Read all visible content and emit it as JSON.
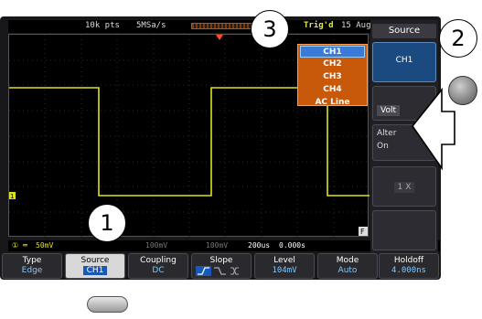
{
  "top_bar": {
    "record_length": "10k pts",
    "sample_rate": "5MSa/s",
    "trigger_status": "Trig'd",
    "date": "15 Aug"
  },
  "source_dropdown": {
    "items": [
      "CH1",
      "CH2",
      "CH3",
      "CH4",
      "AC Line"
    ],
    "selected": "CH1"
  },
  "side_menu": {
    "title": "Source",
    "source_value": "CH1",
    "slot_extra_label": "Volt",
    "alternate_label": "Alter",
    "alternate_value": "On",
    "slot_bottom_value": "1 X"
  },
  "status_bar": {
    "ch1_scale": "50mV",
    "ch3_scale": "100mV",
    "ch4_scale": "100mV",
    "timebase": "200us",
    "h_position": "0.000s",
    "trigger_marker": "f"
  },
  "bottom_menu": [
    {
      "label": "Type",
      "value": "Edge"
    },
    {
      "label": "Source",
      "value": "CH1"
    },
    {
      "label": "Coupling",
      "value": "DC"
    },
    {
      "label": "Slope",
      "value": ""
    },
    {
      "label": "Level",
      "value": "104mV"
    },
    {
      "label": "Mode",
      "value": "Auto"
    },
    {
      "label": "Holdoff",
      "value": "4.000ns"
    }
  ],
  "callouts": [
    "1",
    "2",
    "3"
  ],
  "markers": {
    "ch1_ground": "1",
    "f_marker": "F"
  },
  "colors": {
    "trace": "#e0e020",
    "menu_selected": "#1a58b8",
    "dropdown": "#c8580a",
    "trigger": "#ff4a2a"
  }
}
